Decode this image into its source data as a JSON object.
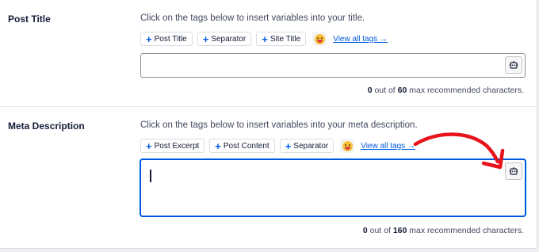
{
  "post_title": {
    "label": "Post Title",
    "hint": "Click on the tags below to insert variables into your title.",
    "tags": [
      "Post Title",
      "Separator",
      "Site Title"
    ],
    "view_all": "View all tags →",
    "count_value": "0",
    "count_max": "60",
    "count_suffix": "max recommended characters.",
    "count_mid": "out of",
    "value": ""
  },
  "meta_description": {
    "label": "Meta Description",
    "hint": "Click on the tags below to insert variables into your meta description.",
    "tags": [
      "Post Excerpt",
      "Post Content",
      "Separator"
    ],
    "view_all": "View all tags →",
    "count_value": "0",
    "count_max": "160",
    "count_suffix": "max recommended characters.",
    "count_mid": "out of",
    "value": ""
  },
  "icons": {
    "tag_plus": "plus-icon",
    "emoji": "emoji-icon",
    "ai_button": "robot-icon",
    "annotation": "red-arrow-icon"
  },
  "colors": {
    "accent": "#005ae0",
    "text": "#141b38",
    "annotation": "#e8121b"
  }
}
